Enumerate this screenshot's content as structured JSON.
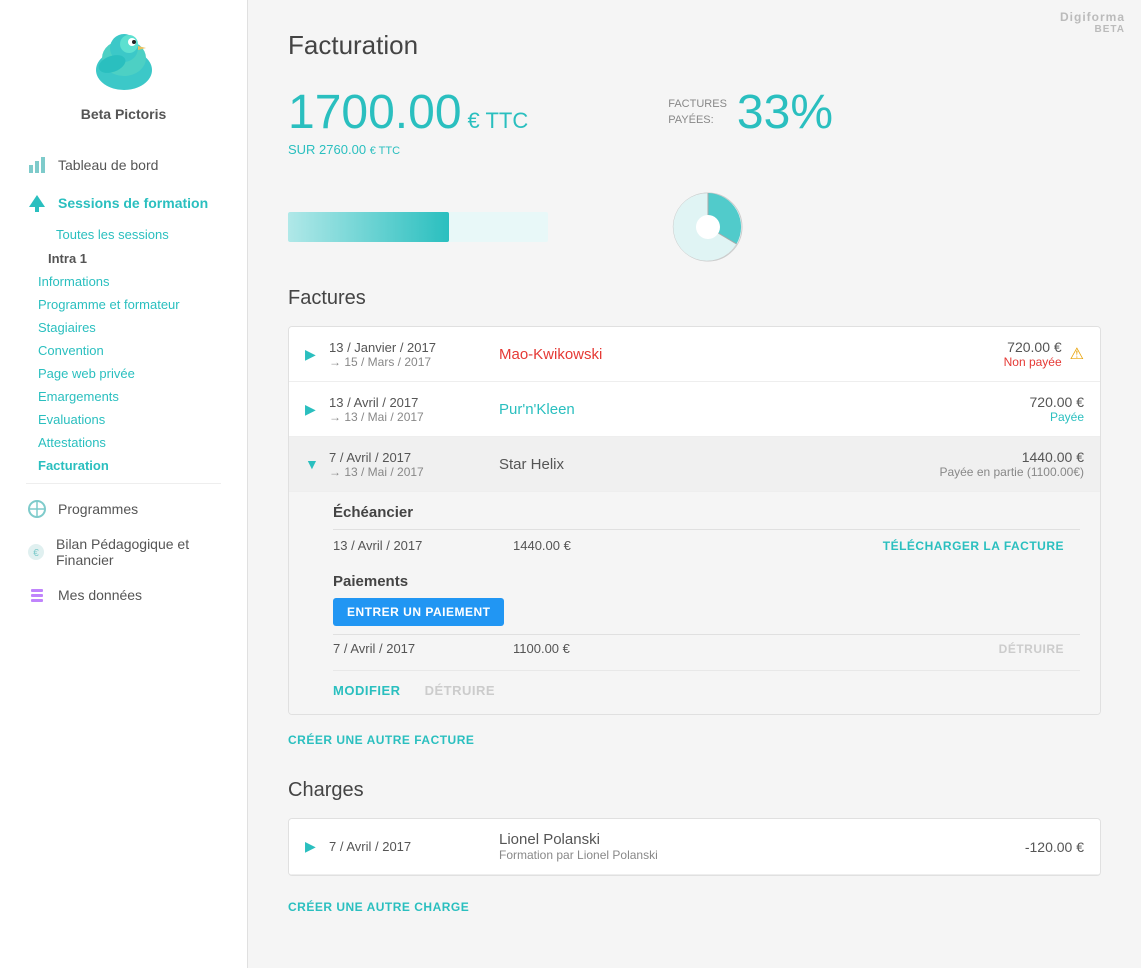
{
  "app": {
    "name": "Beta Pictoris",
    "watermark": "Digiforma",
    "beta": "BETA"
  },
  "sidebar": {
    "sections": [
      {
        "id": "tableau-bord",
        "label": "Tableau de bord",
        "icon": "chart-icon",
        "active": false
      },
      {
        "id": "sessions",
        "label": "Sessions de formation",
        "icon": "tree-icon",
        "active": true
      }
    ],
    "sessions_sub": [
      {
        "id": "toutes-sessions",
        "label": "Toutes les sessions"
      }
    ],
    "intra_label": "Intra 1",
    "intra_sub": [
      {
        "id": "informations",
        "label": "Informations"
      },
      {
        "id": "programme-formateur",
        "label": "Programme et formateur"
      },
      {
        "id": "stagiaires",
        "label": "Stagiaires"
      },
      {
        "id": "convention",
        "label": "Convention"
      },
      {
        "id": "page-web-privee",
        "label": "Page web privée"
      },
      {
        "id": "emargements",
        "label": "Emargements"
      },
      {
        "id": "evaluations",
        "label": "Evaluations"
      },
      {
        "id": "attestations",
        "label": "Attestations"
      },
      {
        "id": "facturation",
        "label": "Facturation",
        "active": true
      }
    ],
    "other_sections": [
      {
        "id": "programmes",
        "label": "Programmes",
        "icon": "programs-icon"
      },
      {
        "id": "bilan",
        "label": "Bilan Pédagogique et Financier",
        "icon": "bilan-icon"
      },
      {
        "id": "mes-donnees",
        "label": "Mes données",
        "icon": "data-icon"
      }
    ]
  },
  "main": {
    "page_title": "Facturation",
    "stats": {
      "amount": "1700.00",
      "currency": "€ TTC",
      "sur_label": "SUR 2760.00",
      "sur_currency": "€ TTC",
      "paid_label": "FACTURES\nPAYÉES:",
      "paid_pct": "33%",
      "progress_pct": 62
    },
    "factures_title": "Factures",
    "factures": [
      {
        "id": "f1",
        "date_main": "13 / Janvier / 2017",
        "date_arrow": "→ 15 / Mars / 2017",
        "client": "Mao-Kwikowski",
        "client_class": "unpaid",
        "amount": "720.00 €",
        "status": "Non payée",
        "status_class": "unpaid",
        "warning": true,
        "expanded": false
      },
      {
        "id": "f2",
        "date_main": "13 / Avril / 2017",
        "date_arrow": "→ 13 / Mai / 2017",
        "client": "Pur'n'Kleen",
        "client_class": "paid",
        "amount": "720.00 €",
        "status": "Payée",
        "status_class": "paid",
        "warning": false,
        "expanded": false
      },
      {
        "id": "f3",
        "date_main": "7 / Avril / 2017",
        "date_arrow": "→ 13 / Mai / 2017",
        "client": "Star Helix",
        "client_class": "neutral",
        "amount": "1440.00 €",
        "status": "Payée en partie (1100.00€)",
        "status_class": "partial",
        "warning": false,
        "expanded": true,
        "echeancier": {
          "title": "Échéancier",
          "rows": [
            {
              "date": "13 / Avril / 2017",
              "amount": "1440.00 €",
              "action": "TÉLÉCHARGER LA FACTURE"
            }
          ]
        },
        "paiements": {
          "title": "Paiements",
          "btn_label": "ENTRER UN PAIEMENT",
          "rows": [
            {
              "date": "7 / Avril / 2017",
              "amount": "1100.00 €",
              "action": "DÉTRUIRE"
            }
          ]
        },
        "actions": {
          "modifier": "MODIFIER",
          "detruire": "DÉTRUIRE"
        }
      }
    ],
    "create_facture_label": "CRÉER UNE AUTRE FACTURE",
    "charges_title": "Charges",
    "charges": [
      {
        "id": "c1",
        "date_main": "7 / Avril / 2017",
        "client_name": "Lionel Polanski",
        "client_sub": "Formation par Lionel Polanski",
        "amount": "-120.00 €"
      }
    ],
    "create_charge_label": "CRÉER UNE AUTRE CHARGE"
  }
}
